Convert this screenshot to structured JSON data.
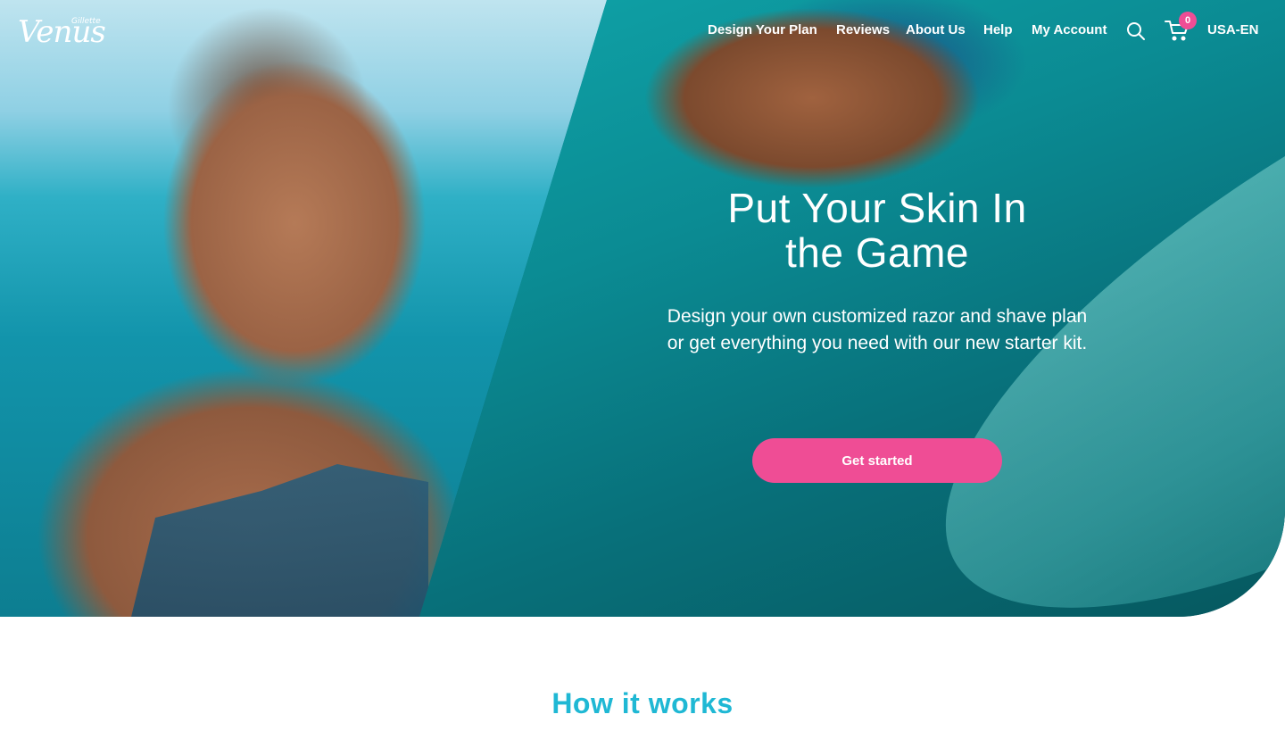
{
  "brand": {
    "logo_text": "Venus",
    "logo_subtext": "Gillette"
  },
  "nav": {
    "items": [
      {
        "label": "Design Your Plan"
      },
      {
        "label": "Reviews"
      },
      {
        "label": "About Us"
      },
      {
        "label": "Help"
      },
      {
        "label": "My Account"
      }
    ],
    "search_icon": "search-icon",
    "cart_icon": "cart-icon",
    "cart_count": "0",
    "locale": "USA-EN"
  },
  "hero": {
    "title_line1": "Put Your Skin In",
    "title_line2": "the Game",
    "subtitle": "Design your own customized razor and shave plan or get everything you need with our new starter kit.",
    "cta_label": "Get started"
  },
  "how_it_works": {
    "heading": "How it works"
  },
  "colors": {
    "accent_pink": "#ef4d95",
    "heading_teal": "#1fb8d4"
  }
}
